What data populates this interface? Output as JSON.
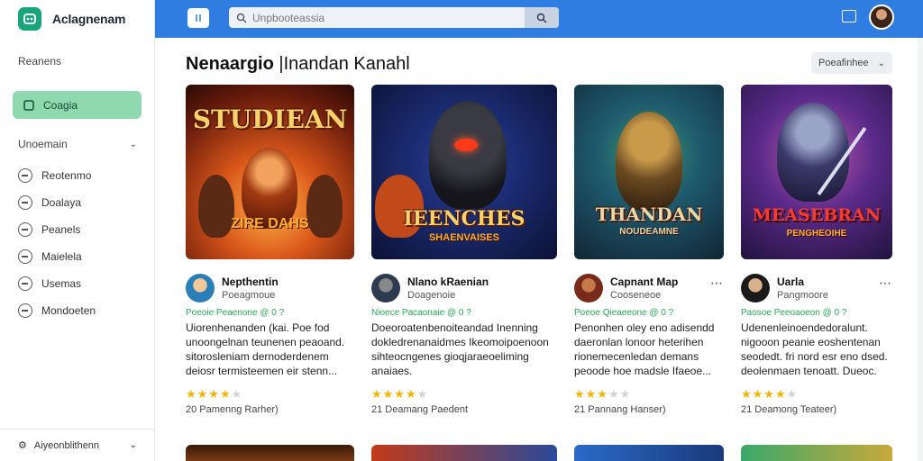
{
  "app": {
    "brand": "Aclagnenam"
  },
  "sidebar": {
    "section1": "Reanens",
    "active": "Coagia",
    "section2": "Unoemain",
    "items": [
      {
        "label": "Reotenmo"
      },
      {
        "label": "Doalaya"
      },
      {
        "label": "Peanels"
      },
      {
        "label": "Maielela"
      },
      {
        "label": "Usemas"
      },
      {
        "label": "Mondoeten"
      }
    ],
    "footer": "Aiyeonblithenn"
  },
  "header": {
    "search_placeholder": "Unpbooteassia"
  },
  "main": {
    "title_bold": "Nenaargio",
    "title_rest": "|Inandan Kanahl",
    "sort_label": "Poeafinhee"
  },
  "cards": [
    {
      "thumb_title": "STUDIEAN",
      "thumb_sub": "ZIRE DAHS",
      "name": "Nepthentin",
      "dev": "Poeagmoue",
      "tag": "Poeoie Peaenone @ 0 ?",
      "desc": "Uiorenhenanden (kai. Poe fod unoongelnan teunenen peaoand. sitorosleniam dernoderdenem deiosr termisteemen eir stenn...",
      "stars": 4,
      "rating": "20 Pamenng Rarher)"
    },
    {
      "thumb_title": "IEENCHES",
      "thumb_sub": "SHAENVAISES",
      "name": "Nlano kRaenian",
      "dev": "Doagenoie",
      "tag": "Nioece Pacaonaie @ 0 ?",
      "desc": "Doeoroatenbenoiteandad Inenning dokledrenanaidmes Ikeomoipoenoon sihteocngenes gioqjaraeoeliming anaiaes.",
      "stars": 4,
      "rating": "21 Deamang Paedent"
    },
    {
      "thumb_title": "THANDAN",
      "thumb_sub": "NOUDEAMNE",
      "name": "Capnant Map",
      "dev": "Cooseneoe",
      "tag": "Poeoe Qieaeeone @ 0 ?",
      "desc": "Penonhen oley eno adisendd daeronlan lonoor heterihen rionemecenledan demans peoode hoe madsle Ifaeoe...",
      "stars": 3,
      "rating": "21 Pannang Hanser)"
    },
    {
      "thumb_title": "MEASEBRAN",
      "thumb_sub": "PENGHEOIHE",
      "name": "Uarla",
      "dev": "Pangmoore",
      "tag": "Paosoe Peeoaoeon @ 0 ?",
      "desc": "Udenenleinoendedoralunt. nigooon peanie eoshentenan seodedt. fri nord esr eno dsed. deolenmaen tenoatt. Dueoc. Ibadenecepian teonabt.",
      "stars": 4,
      "rating": "21 Deamong Teateer)"
    }
  ],
  "colors": {
    "header": "#2f7de1",
    "active_nav": "#8fd9b0",
    "brand": "#18a57c",
    "star": "#f4b400",
    "tag": "#2aa55a"
  }
}
